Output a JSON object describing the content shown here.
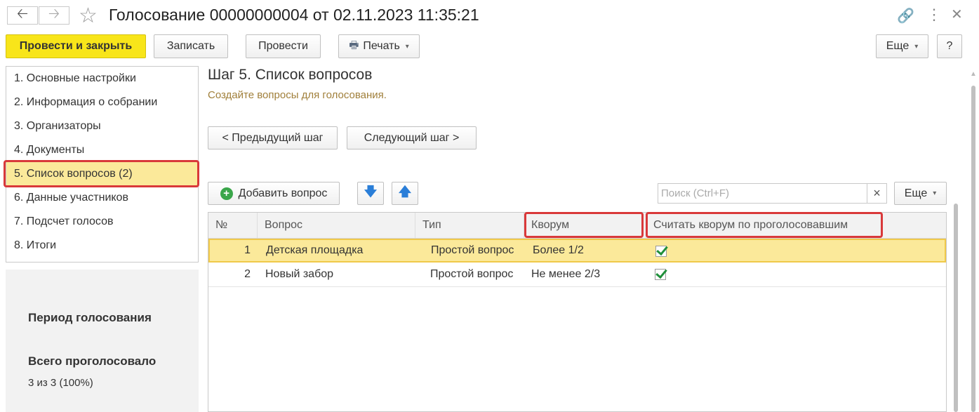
{
  "window": {
    "title": "Голосование 00000000004 от 02.11.2023 11:35:21",
    "back_icon": "arrow-left-icon",
    "forward_icon": "arrow-right-icon"
  },
  "toolbar": {
    "post_close": "Провести и закрыть",
    "save": "Записать",
    "post": "Провести",
    "print": "Печать",
    "more": "Еще",
    "help": "?"
  },
  "sidebar": {
    "items": [
      {
        "label": "1. Основные настройки"
      },
      {
        "label": "2. Информация о собрании"
      },
      {
        "label": "3. Организаторы"
      },
      {
        "label": "4. Документы"
      },
      {
        "label": "5. Список вопросов (2)"
      },
      {
        "label": "6. Данные участников"
      },
      {
        "label": "7. Подсчет голосов"
      },
      {
        "label": "8. Итоги"
      }
    ],
    "selected_index": 4
  },
  "summary": {
    "period_label": "Период голосования",
    "total_label": "Всего проголосовало",
    "total_value": "3 из 3 (100%)"
  },
  "step": {
    "title": "Шаг 5. Список вопросов",
    "subtitle": "Создайте вопросы для голосования.",
    "prev": "< Предыдущий шаг",
    "next": "Следующий шаг >"
  },
  "list_toolbar": {
    "add": "Добавить вопрос",
    "search_placeholder": "Поиск (Ctrl+F)",
    "clear": "×",
    "more": "Еще"
  },
  "table": {
    "columns": [
      "№",
      "Вопрос",
      "Тип",
      "Кворум",
      "Считать кворум по проголосовавшим"
    ],
    "rows": [
      {
        "num": "1",
        "question": "Детская площадка",
        "type": "Простой вопрос",
        "quorum": "Более 1/2",
        "count_voted": true
      },
      {
        "num": "2",
        "question": "Новый забор",
        "type": "Простой вопрос",
        "quorum": "Не менее 2/3",
        "count_voted": true
      }
    ]
  },
  "colors": {
    "accent": "#f8e51a",
    "selection": "#fbe99a",
    "highlight": "#d9393a",
    "subtitle": "#a07f3a"
  }
}
